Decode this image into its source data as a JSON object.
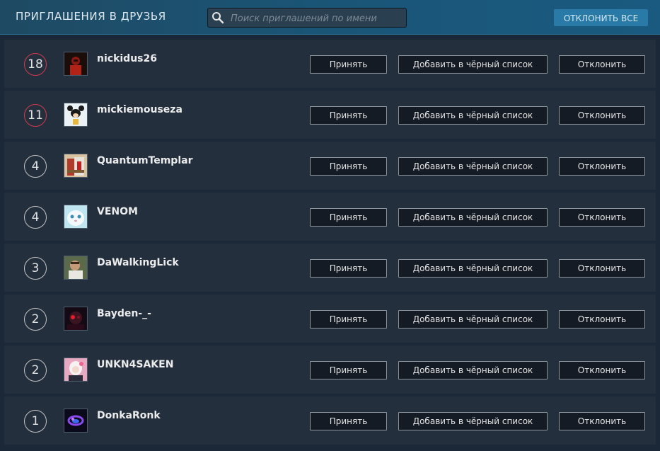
{
  "header": {
    "title": "ПРИГЛАШЕНИЯ В ДРУЗЬЯ",
    "search_placeholder": "Поиск приглашений по имени",
    "decline_all_label": "ОТКЛОНИТЬ ВСЕ"
  },
  "actions": {
    "accept_label": "Принять",
    "block_label": "Добавить в чёрный список",
    "decline_label": "Отклонить"
  },
  "invites": [
    {
      "level": "18",
      "name": "nickidus26",
      "badge_color": "#d23b4a"
    },
    {
      "level": "11",
      "name": "mickiemouseza",
      "badge_color": "#d23b4a"
    },
    {
      "level": "4",
      "name": "QuantumTemplar",
      "badge_color": "#c4c4c4"
    },
    {
      "level": "4",
      "name": "VENOM",
      "badge_color": "#c4c4c4"
    },
    {
      "level": "3",
      "name": "DaWalkingLick",
      "badge_color": "#c4c4c4"
    },
    {
      "level": "2",
      "name": "Bayden-_-",
      "badge_color": "#c4c4c4"
    },
    {
      "level": "2",
      "name": "UNKN4SAKEN",
      "badge_color": "#c4c4c4"
    },
    {
      "level": "1",
      "name": "DonkaRonk",
      "badge_color": "#c4c4c4"
    }
  ]
}
